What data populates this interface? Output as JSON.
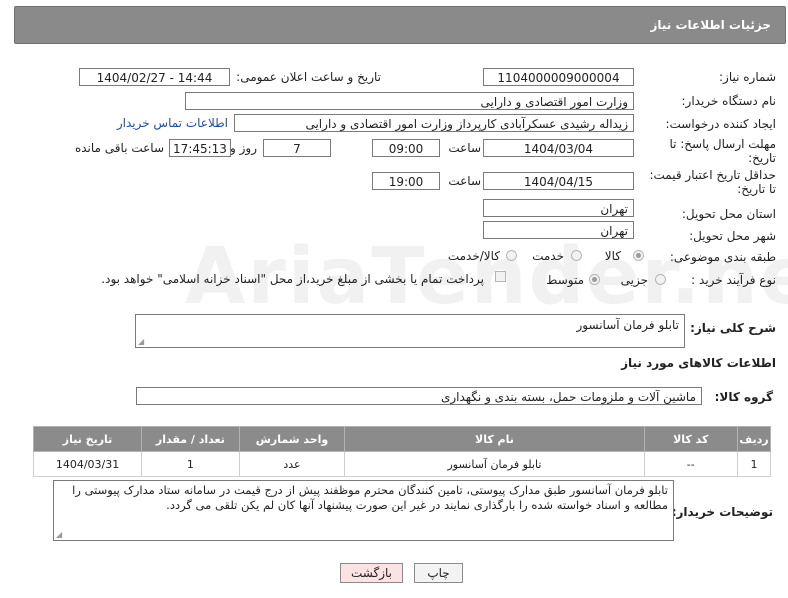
{
  "header": {
    "title": "جزئیات اطلاعات نیاز"
  },
  "form": {
    "need_number": {
      "label": "شماره نیاز:",
      "value": "1104000009000004"
    },
    "announce_datetime": {
      "label": "تاریخ و ساعت اعلان عمومی:",
      "value": "1404/02/27 - 14:44"
    },
    "buyer_org": {
      "label": "نام دستگاه خریدار:",
      "value": "وزارت امور اقتصادی و دارایی"
    },
    "requester": {
      "label": "ایجاد کننده درخواست:",
      "value": "زیداله رشیدی عسکرآبادی کارپرداز وزارت امور اقتصادی و دارایی",
      "contact_link": "اطلاعات تماس خریدار"
    },
    "reply_deadline": {
      "label_line1": "مهلت ارسال پاسخ: تا",
      "label_line2": "تاریخ:",
      "date": "1404/03/04",
      "time_label": "ساعت",
      "time": "09:00",
      "days": "7",
      "days_label": "روز و",
      "remaining_time": "17:45:13",
      "remaining_label": "ساعت باقی مانده"
    },
    "price_validity": {
      "label_line1": "حداقل تاریخ اعتبار قیمت:",
      "label_line2": "تا تاریخ:",
      "date": "1404/04/15",
      "time_label": "ساعت",
      "time": "19:00"
    },
    "delivery_province": {
      "label": "استان محل تحویل:",
      "value": "تهران"
    },
    "delivery_city": {
      "label": "شهر محل تحویل:",
      "value": "تهران"
    },
    "category": {
      "label": "طبقه بندی موضوعی:",
      "options": [
        "کالا",
        "خدمت",
        "کالا/خدمت"
      ],
      "selected": "کالا"
    },
    "purchase_process": {
      "label": "نوع فرآیند خرید :",
      "options": [
        "جزیی",
        "متوسط"
      ],
      "selected": "متوسط",
      "payment_note": "پرداخت تمام یا بخشی از مبلغ خرید،از محل \"اسناد خزانه اسلامی\" خواهد بود."
    }
  },
  "description": {
    "label": "شرح کلی نیاز:",
    "value": "تابلو فرمان آسانسور"
  },
  "goods_section": {
    "title": "اطلاعات کالاهای مورد نیاز"
  },
  "goods_group": {
    "label": "گروه کالا:",
    "value": "ماشین آلات و ملزومات حمل، بسته بندی و نگهداری"
  },
  "items_table": {
    "headers": {
      "row": "ردیف",
      "code": "کد کالا",
      "name": "نام کالا",
      "unit": "واحد شمارش",
      "qty": "تعداد / مقدار",
      "date": "تاریخ نیاز"
    },
    "rows": [
      {
        "row": "1",
        "code": "--",
        "name": "تابلو فرمان آسانسور",
        "unit": "عدد",
        "qty": "1",
        "date": "1404/03/31"
      }
    ]
  },
  "buyer_notes": {
    "label": "توضیحات خریدار:",
    "value": "تابلو فرمان آسانسور طبق مدارک پیوستی، تامین کنندگان محترم موظفند پیش از درج قیمت در سامانه ستاد مدارک پیوستی را مطالعه و اسناد خواسته شده را بارگذاری نمایند در غیر این صورت پیشنهاد آنها کان لم یکن تلقی می گردد."
  },
  "buttons": {
    "print": "چاپ",
    "back": "بازگشت"
  },
  "watermark": {
    "text": "AriaTender.neT"
  },
  "colors": {
    "header_bg": "#8a8a8a",
    "link": "#1a4fa8",
    "back_button_bg": "#fbe3e3"
  }
}
